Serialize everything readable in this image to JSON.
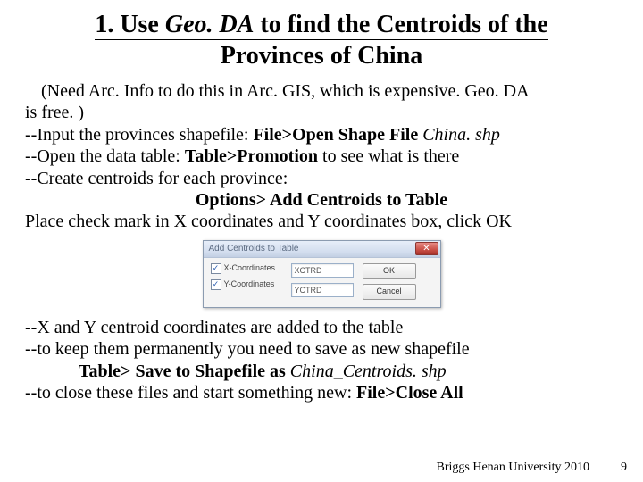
{
  "title": {
    "prefix": "1. Use ",
    "geoda": "Geo. DA",
    "middle": " to find the Centroids of the",
    "line2": "Provinces of China"
  },
  "body": {
    "note_pre": "(Need Arc. Info to do this in Arc. GIS, which is expensive.  Geo. DA",
    "note_post": "is free. )",
    "l1_pre": "--Input the provinces shapefile:  ",
    "l1_b": "File>Open Shape File",
    "l1_it": "   China. shp",
    "l2_pre": "--Open the data table:  ",
    "l2_b": "Table>Promotion",
    "l2_post": "  to see what is there",
    "l3": "--Create centroids for each province:",
    "l4_b": "Options> Add Centroids to Table",
    "l5": "Place check mark in X coordinates and Y coordinates box, click OK",
    "l6": "--X and Y centroid coordinates are added to the table",
    "l7": "--to keep them permanently you need to save as new shapefile",
    "l8_b": "Table> Save to Shapefile as",
    "l8_it": "   China_Centroids. shp",
    "l9_pre": "--to close these files and start something new:  ",
    "l9_b": "File>Close All"
  },
  "dialog": {
    "title": "Add Centroids to Table",
    "close": "✕",
    "chk1": "X-Coordinates",
    "chk2": "Y-Coordinates",
    "check": "✓",
    "f1": "XCTRD",
    "f2": "YCTRD",
    "ok": "OK",
    "cancel": "Cancel"
  },
  "footer": "Briggs  Henan University 2010",
  "page": "9"
}
